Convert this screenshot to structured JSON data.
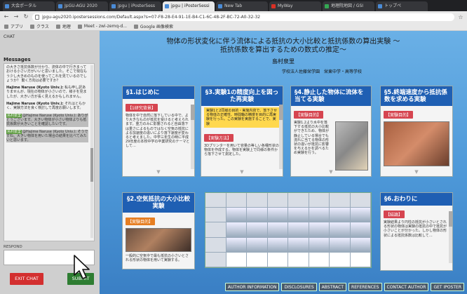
{
  "tabs": [
    {
      "label": "大会ポータル",
      "type": "default"
    },
    {
      "label": "JpGU-AGU 2020",
      "type": "default"
    },
    {
      "label": "jpgu | iPosterSess",
      "type": "default"
    },
    {
      "label": "jpgu | iPosterSessi",
      "type": "active"
    },
    {
      "label": "New Tab",
      "type": "default"
    },
    {
      "label": "MyWay",
      "type": "gmail"
    },
    {
      "label": "地理院地図 / GSI",
      "type": "map"
    },
    {
      "label": "トップペ",
      "type": "default"
    }
  ],
  "address": "jpgu-agu2020.ipostersessions.com/Default.aspx?s=07-F8-28-E4-91-1E-B4-C1-6C-48-2F-BC-72-A0-32-32",
  "bookmarks": [
    "アプリ",
    "クラス",
    "地理",
    "Meet - zwi-zemq-d...",
    "Google 画像検索"
  ],
  "chat": {
    "title": "CHAT",
    "messages_label": "Messages",
    "messages": [
      {
        "author": "",
        "badge": "",
        "text": "の大きさ抵抗係数が分かり、流体の中で行きまっておける小さい方がいいと思いました。そこで現在もう少し大きめのものを使ってこれを見ているのでしょうか？ 動く方向は必要ですか？",
        "highlight": false
      },
      {
        "author": "Hajime Naruse (Kyoto Univ.):",
        "badge": "",
        "text": "私も申し訳ありませんが、現在の物体が小さいので、様子を見ましたが、大きい方が長く見えるかもしれません。",
        "highlight": false
      },
      {
        "author": "Hajime Naruse (Kyoto Univ.):",
        "badge": "",
        "text": "それはともかく、実験方法を良く検討して再度お願いします。",
        "highlight": false
      },
      {
        "author": "",
        "badge": "島村泉里",
        "text": "@Hajime Naruse (Kyoto Univ.): ありがとうございます。大きい物体が小さい物体よりも抵抗係数が大きいことを確認したいです。",
        "highlight": true
      },
      {
        "author": "",
        "badge": "島村泉里",
        "text": "@Hajime Naruse (Kyoto Univ.): そうですね。大きい物体を用いた場合の結果を比べてみたいと思います。",
        "highlight": true
      }
    ],
    "respond_label": "RESPOND",
    "exit_label": "EXIT CHAT",
    "submit_label": "SUBMIT"
  },
  "poster": {
    "title_line1": "物体の形状変化に伴う流体による抵抗の大小比較と抵抗係数の算出実験 ～",
    "title_line2": "抵抗係数を算出するための数式の推定～",
    "author": "島村泉里",
    "affiliation": "学校法人佐藤栄学園　栄東中学・高等学校",
    "sections": [
      {
        "title": "§1.はじめに",
        "sub": "【1研究背景】",
        "text": "物体を中で自然に落下している中で、より大きなものが抵抗を受けると考えられます。重力のみに影響されると自由落下は重さによるものではなく空気の抵抗による加速度の違いにより落下速度が変わると考えました。中学三年生の時に平成29年度の本校中学の卒業研究のテーマとして…",
        "sub_color": "red"
      },
      {
        "title": "§3.実験1の精度向上を図った再実験",
        "sub": "【実験方法】",
        "highlight": "実験1と2同様の目的・実施内容で、落下させる物体の正確性、時間軸の精度を目的に再実験を行った。この実験を実施することで、実験",
        "text": "3Dプリンターを用いて容量の等しい各種形状の物体を作成する。物体を実験上で同様の条件から落下させて測定した。",
        "sub_color": "red"
      },
      {
        "title": "§4.静止した物体に流体を当てる実験",
        "sub": "【実験目的】",
        "text": "実験1.2より水中を落下する抵抗の大小比較ができたため、物体が静止している場合でも流れに当てる物体の形状の違いが抵抗に影響を与えるかを調べるため実験を行う。",
        "sub_color": "red"
      },
      {
        "title": "§5.終端速度から抵抗係数を求める実験",
        "sub": "【実験目的】",
        "text": "物体を落下させ、終端速度から抵抗係数を求める。",
        "sub_color": "red"
      },
      {
        "title": "§2.空気抵抗の大小比較実験",
        "sub": "【実験目的】",
        "text": "一般的に空気中で最も抵抗の小さいとされる形状の物体を用いて実験する。",
        "sub_color": "red"
      },
      {
        "title": "§6.おわりに",
        "sub": "【結論】",
        "text": "実験結果より円柱の抵抗が小さいとされる形状の物体は実験の抵抗の中で抵抗が小さいことが分かった。しかし物体の形状による抵抗係数は比較して…",
        "sub_color": "red"
      }
    ],
    "table": {
      "header": [
        "",
        "",
        "",
        "",
        "",
        "",
        "",
        "",
        ""
      ],
      "rows": 5
    },
    "footer_buttons": [
      "AUTHOR INFORMATION",
      "DISCLOSURES",
      "ABSTRACT",
      "REFERENCES",
      "CONTACT AUTHOR",
      "GET IPOSTER"
    ]
  }
}
